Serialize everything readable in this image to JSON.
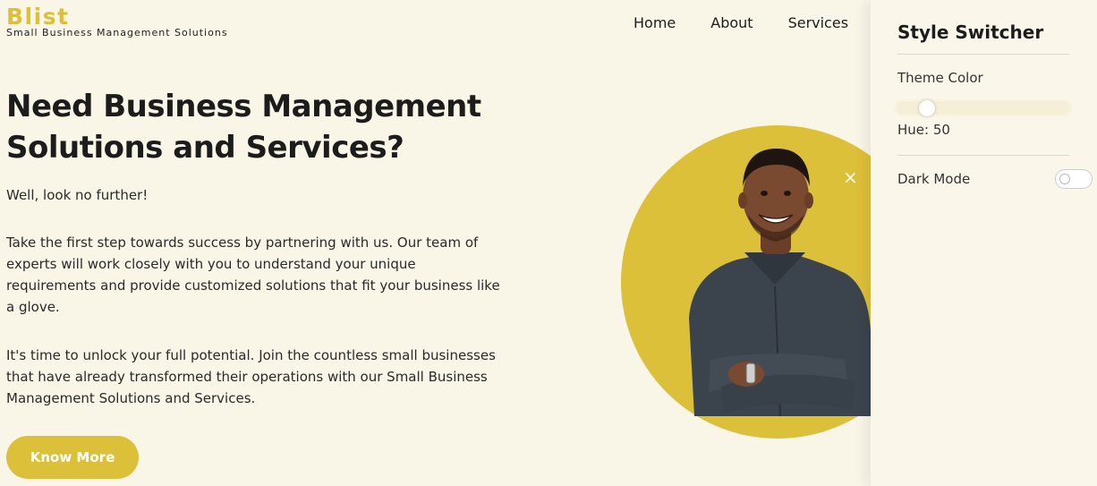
{
  "brand": {
    "name": "Blist",
    "tagline": "Small Business Management Solutions"
  },
  "nav": {
    "items": [
      "Home",
      "About",
      "Services"
    ]
  },
  "hero": {
    "title": "Need Business Management Solutions and Services?",
    "intro": "Well, look no further!",
    "paragraph1": "Take the first step towards success by partnering with us. Our team of experts will work closely with you to understand your unique requirements and provide customized solutions that fit your business like a glove.",
    "paragraph2": "It's time to unlock your full potential. Join the countless small businesses that have already transformed their operations with our Small Business Management Solutions and Services.",
    "cta_label": "Know More"
  },
  "style_switcher": {
    "title": "Style Switcher",
    "theme_color_label": "Theme Color",
    "hue_text": "Hue: 50",
    "hue_value": 50,
    "hue_max": 360,
    "dark_mode_label": "Dark Mode",
    "dark_mode_on": false,
    "close_glyph": "×"
  },
  "colors": {
    "accent": "#dcc03a",
    "background": "#f9f5e7"
  }
}
